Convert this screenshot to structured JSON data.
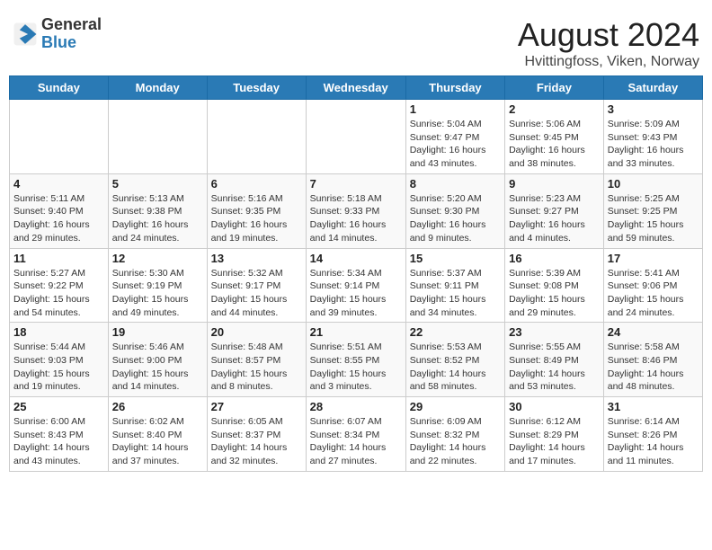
{
  "header": {
    "logo_line1": "General",
    "logo_line2": "Blue",
    "month_year": "August 2024",
    "location": "Hvittingfoss, Viken, Norway"
  },
  "days_of_week": [
    "Sunday",
    "Monday",
    "Tuesday",
    "Wednesday",
    "Thursday",
    "Friday",
    "Saturday"
  ],
  "weeks": [
    [
      {
        "day": "",
        "info": ""
      },
      {
        "day": "",
        "info": ""
      },
      {
        "day": "",
        "info": ""
      },
      {
        "day": "",
        "info": ""
      },
      {
        "day": "1",
        "info": "Sunrise: 5:04 AM\nSunset: 9:47 PM\nDaylight: 16 hours\nand 43 minutes."
      },
      {
        "day": "2",
        "info": "Sunrise: 5:06 AM\nSunset: 9:45 PM\nDaylight: 16 hours\nand 38 minutes."
      },
      {
        "day": "3",
        "info": "Sunrise: 5:09 AM\nSunset: 9:43 PM\nDaylight: 16 hours\nand 33 minutes."
      }
    ],
    [
      {
        "day": "4",
        "info": "Sunrise: 5:11 AM\nSunset: 9:40 PM\nDaylight: 16 hours\nand 29 minutes."
      },
      {
        "day": "5",
        "info": "Sunrise: 5:13 AM\nSunset: 9:38 PM\nDaylight: 16 hours\nand 24 minutes."
      },
      {
        "day": "6",
        "info": "Sunrise: 5:16 AM\nSunset: 9:35 PM\nDaylight: 16 hours\nand 19 minutes."
      },
      {
        "day": "7",
        "info": "Sunrise: 5:18 AM\nSunset: 9:33 PM\nDaylight: 16 hours\nand 14 minutes."
      },
      {
        "day": "8",
        "info": "Sunrise: 5:20 AM\nSunset: 9:30 PM\nDaylight: 16 hours\nand 9 minutes."
      },
      {
        "day": "9",
        "info": "Sunrise: 5:23 AM\nSunset: 9:27 PM\nDaylight: 16 hours\nand 4 minutes."
      },
      {
        "day": "10",
        "info": "Sunrise: 5:25 AM\nSunset: 9:25 PM\nDaylight: 15 hours\nand 59 minutes."
      }
    ],
    [
      {
        "day": "11",
        "info": "Sunrise: 5:27 AM\nSunset: 9:22 PM\nDaylight: 15 hours\nand 54 minutes."
      },
      {
        "day": "12",
        "info": "Sunrise: 5:30 AM\nSunset: 9:19 PM\nDaylight: 15 hours\nand 49 minutes."
      },
      {
        "day": "13",
        "info": "Sunrise: 5:32 AM\nSunset: 9:17 PM\nDaylight: 15 hours\nand 44 minutes."
      },
      {
        "day": "14",
        "info": "Sunrise: 5:34 AM\nSunset: 9:14 PM\nDaylight: 15 hours\nand 39 minutes."
      },
      {
        "day": "15",
        "info": "Sunrise: 5:37 AM\nSunset: 9:11 PM\nDaylight: 15 hours\nand 34 minutes."
      },
      {
        "day": "16",
        "info": "Sunrise: 5:39 AM\nSunset: 9:08 PM\nDaylight: 15 hours\nand 29 minutes."
      },
      {
        "day": "17",
        "info": "Sunrise: 5:41 AM\nSunset: 9:06 PM\nDaylight: 15 hours\nand 24 minutes."
      }
    ],
    [
      {
        "day": "18",
        "info": "Sunrise: 5:44 AM\nSunset: 9:03 PM\nDaylight: 15 hours\nand 19 minutes."
      },
      {
        "day": "19",
        "info": "Sunrise: 5:46 AM\nSunset: 9:00 PM\nDaylight: 15 hours\nand 14 minutes."
      },
      {
        "day": "20",
        "info": "Sunrise: 5:48 AM\nSunset: 8:57 PM\nDaylight: 15 hours\nand 8 minutes."
      },
      {
        "day": "21",
        "info": "Sunrise: 5:51 AM\nSunset: 8:55 PM\nDaylight: 15 hours\nand 3 minutes."
      },
      {
        "day": "22",
        "info": "Sunrise: 5:53 AM\nSunset: 8:52 PM\nDaylight: 14 hours\nand 58 minutes."
      },
      {
        "day": "23",
        "info": "Sunrise: 5:55 AM\nSunset: 8:49 PM\nDaylight: 14 hours\nand 53 minutes."
      },
      {
        "day": "24",
        "info": "Sunrise: 5:58 AM\nSunset: 8:46 PM\nDaylight: 14 hours\nand 48 minutes."
      }
    ],
    [
      {
        "day": "25",
        "info": "Sunrise: 6:00 AM\nSunset: 8:43 PM\nDaylight: 14 hours\nand 43 minutes."
      },
      {
        "day": "26",
        "info": "Sunrise: 6:02 AM\nSunset: 8:40 PM\nDaylight: 14 hours\nand 37 minutes."
      },
      {
        "day": "27",
        "info": "Sunrise: 6:05 AM\nSunset: 8:37 PM\nDaylight: 14 hours\nand 32 minutes."
      },
      {
        "day": "28",
        "info": "Sunrise: 6:07 AM\nSunset: 8:34 PM\nDaylight: 14 hours\nand 27 minutes."
      },
      {
        "day": "29",
        "info": "Sunrise: 6:09 AM\nSunset: 8:32 PM\nDaylight: 14 hours\nand 22 minutes."
      },
      {
        "day": "30",
        "info": "Sunrise: 6:12 AM\nSunset: 8:29 PM\nDaylight: 14 hours\nand 17 minutes."
      },
      {
        "day": "31",
        "info": "Sunrise: 6:14 AM\nSunset: 8:26 PM\nDaylight: 14 hours\nand 11 minutes."
      }
    ]
  ]
}
